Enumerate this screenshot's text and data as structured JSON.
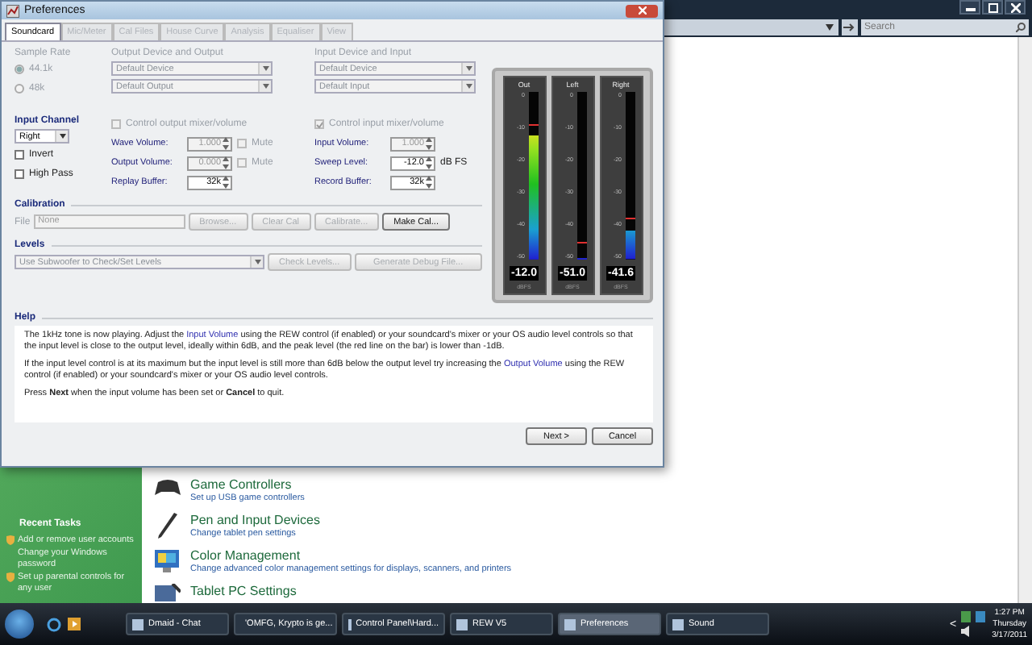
{
  "control_panel": {
    "search": {
      "placeholder": "Search"
    },
    "sidebar": {
      "title": "Recent Tasks",
      "items": [
        "Add or remove user accounts",
        "Change your Windows password",
        "Set up parental controls for any user"
      ]
    },
    "items": [
      {
        "title": "Game Controllers",
        "description": "Set up USB game controllers",
        "kind": "gamepad"
      },
      {
        "title": "Pen and Input Devices",
        "description": "Change tablet pen settings",
        "kind": "pen"
      },
      {
        "title": "Color Management",
        "description": "Change advanced color management settings for displays, scanners, and printers",
        "kind": "color"
      },
      {
        "title": "Tablet PC Settings",
        "kind": "tablet"
      }
    ]
  },
  "dialog": {
    "title": "Preferences",
    "tabs": [
      {
        "label": "Soundcard",
        "selected": true,
        "disabled": false
      },
      {
        "label": "Mic/Meter",
        "selected": false,
        "disabled": true
      },
      {
        "label": "Cal Files",
        "selected": false,
        "disabled": true
      },
      {
        "label": "House Curve",
        "selected": false,
        "disabled": true
      },
      {
        "label": "Analysis",
        "selected": false,
        "disabled": true
      },
      {
        "label": "Equaliser",
        "selected": false,
        "disabled": true
      },
      {
        "label": "View",
        "selected": false,
        "disabled": true
      }
    ],
    "sample_rate": {
      "label": "Sample Rate",
      "disabled": true,
      "options": [
        {
          "label": "44.1k",
          "selected": true
        },
        {
          "label": "48k",
          "selected": false
        }
      ]
    },
    "output_device": {
      "label": "Output Device and Output",
      "disabled": true,
      "dropdowns": [
        "Default Device",
        "Default Output"
      ]
    },
    "input_device": {
      "label": "Input Device and Input",
      "disabled": true,
      "dropdowns": [
        "Default Device",
        "Default Input"
      ]
    },
    "input_channel": {
      "label": "Input Channel",
      "value": "Right",
      "checkboxes": [
        {
          "label": "Invert",
          "checked": false
        },
        {
          "label": "High Pass",
          "checked": false
        }
      ]
    },
    "output_controls": {
      "checkbox": {
        "label": "Control output mixer/volume",
        "checked": false,
        "disabled": true
      },
      "fields": [
        {
          "label": "Wave Volume:",
          "value": "1.000",
          "disabled": true,
          "mute": {
            "label": "Mute",
            "checked": false
          }
        },
        {
          "label": "Output Volume:",
          "value": "0.000",
          "disabled": true,
          "mute": {
            "label": "Mute",
            "checked": false
          }
        },
        {
          "label": "Replay Buffer:",
          "value": "32k",
          "disabled": false
        }
      ]
    },
    "input_controls": {
      "checkbox": {
        "label": "Control input mixer/volume",
        "checked": true,
        "disabled": true
      },
      "fields": [
        {
          "label": "Input Volume:",
          "value": "1.000",
          "disabled": true
        },
        {
          "label": "Sweep Level:",
          "value": "-12.0",
          "disabled": false,
          "unit": "dB FS"
        },
        {
          "label": "Record Buffer:",
          "value": "32k",
          "disabled": false
        }
      ]
    },
    "calibration": {
      "title": "Calibration",
      "file_label": "File",
      "file_value": "None",
      "disabled": true,
      "buttons": [
        {
          "label": "Browse...",
          "disabled": true
        },
        {
          "label": "Clear Cal",
          "disabled": true
        },
        {
          "label": "Calibrate...",
          "disabled": true
        },
        {
          "label": "Make Cal...",
          "disabled": false
        }
      ]
    },
    "levels": {
      "title": "Levels",
      "dropdown": "Use Subwoofer to Check/Set Levels",
      "disabled": true,
      "buttons": [
        {
          "label": "Check Levels...",
          "disabled": true
        },
        {
          "label": "Generate Debug File...",
          "disabled": true
        }
      ]
    },
    "meters": [
      {
        "label": "Out",
        "level": 0.74,
        "peak": {
          "level": 0.8
        },
        "reading": "-12.0",
        "unit": "dBFS",
        "scale": [
          "0",
          "-10",
          "-20",
          "-30",
          "-40",
          "-50"
        ]
      },
      {
        "label": "Left",
        "level": 0,
        "peak": {
          "level": 0.1
        },
        "reading": "-51.0",
        "unit": "dBFS",
        "scale": [
          "0",
          "-10",
          "-20",
          "-30",
          "-40",
          "-50"
        ]
      },
      {
        "label": "Right",
        "level": 0.17,
        "peak": {
          "level": 0.24
        },
        "reading": "-41.6",
        "unit": "dBFS",
        "scale": [
          "0",
          "-10",
          "-20",
          "-30",
          "-40",
          "-50"
        ]
      }
    ],
    "help": {
      "title": "Help",
      "paragraphs": [
        [
          {
            "text": "The 1kHz tone is now playing. Adjust the ",
            "kind": "plain"
          },
          {
            "text": "Input Volume",
            "kind": "term"
          },
          {
            "text": " using the REW control (if enabled) or your soundcard's mixer or your OS audio level controls so that the input level is close to the output level, ideally within 6dB, and the peak level (the red line on the bar) is lower than -1dB.",
            "kind": "plain"
          }
        ],
        [
          {
            "text": "If the input level control is at its maximum but the input level is still more than 6dB below the output level try increasing the ",
            "kind": "plain"
          },
          {
            "text": "Output Volume",
            "kind": "term"
          },
          {
            "text": " using the REW control (if enabled) or your soundcard's mixer or your OS audio level controls.",
            "kind": "plain"
          }
        ],
        [
          {
            "text": "Press **Next** when the input volume has been set or **Cancel** to quit.",
            "kind": "plain"
          }
        ]
      ]
    },
    "buttons": [
      {
        "label": "Next >",
        "disabled": false
      },
      {
        "label": "Cancel",
        "disabled": false
      }
    ]
  },
  "taskbar": {
    "tasks": [
      {
        "label": "Dmaid - Chat",
        "selected": false
      },
      {
        "label": "'OMFG, Krypto is ge...",
        "selected": false
      },
      {
        "label": "Control Panel\\Hard...",
        "selected": false
      },
      {
        "label": "REW V5",
        "selected": false
      },
      {
        "label": "Preferences",
        "selected": true
      },
      {
        "label": "Sound",
        "selected": false
      }
    ],
    "tray_arrow": "<",
    "clock": {
      "time": "1:27 PM",
      "day": "Thursday",
      "date": "3/17/2011"
    }
  }
}
